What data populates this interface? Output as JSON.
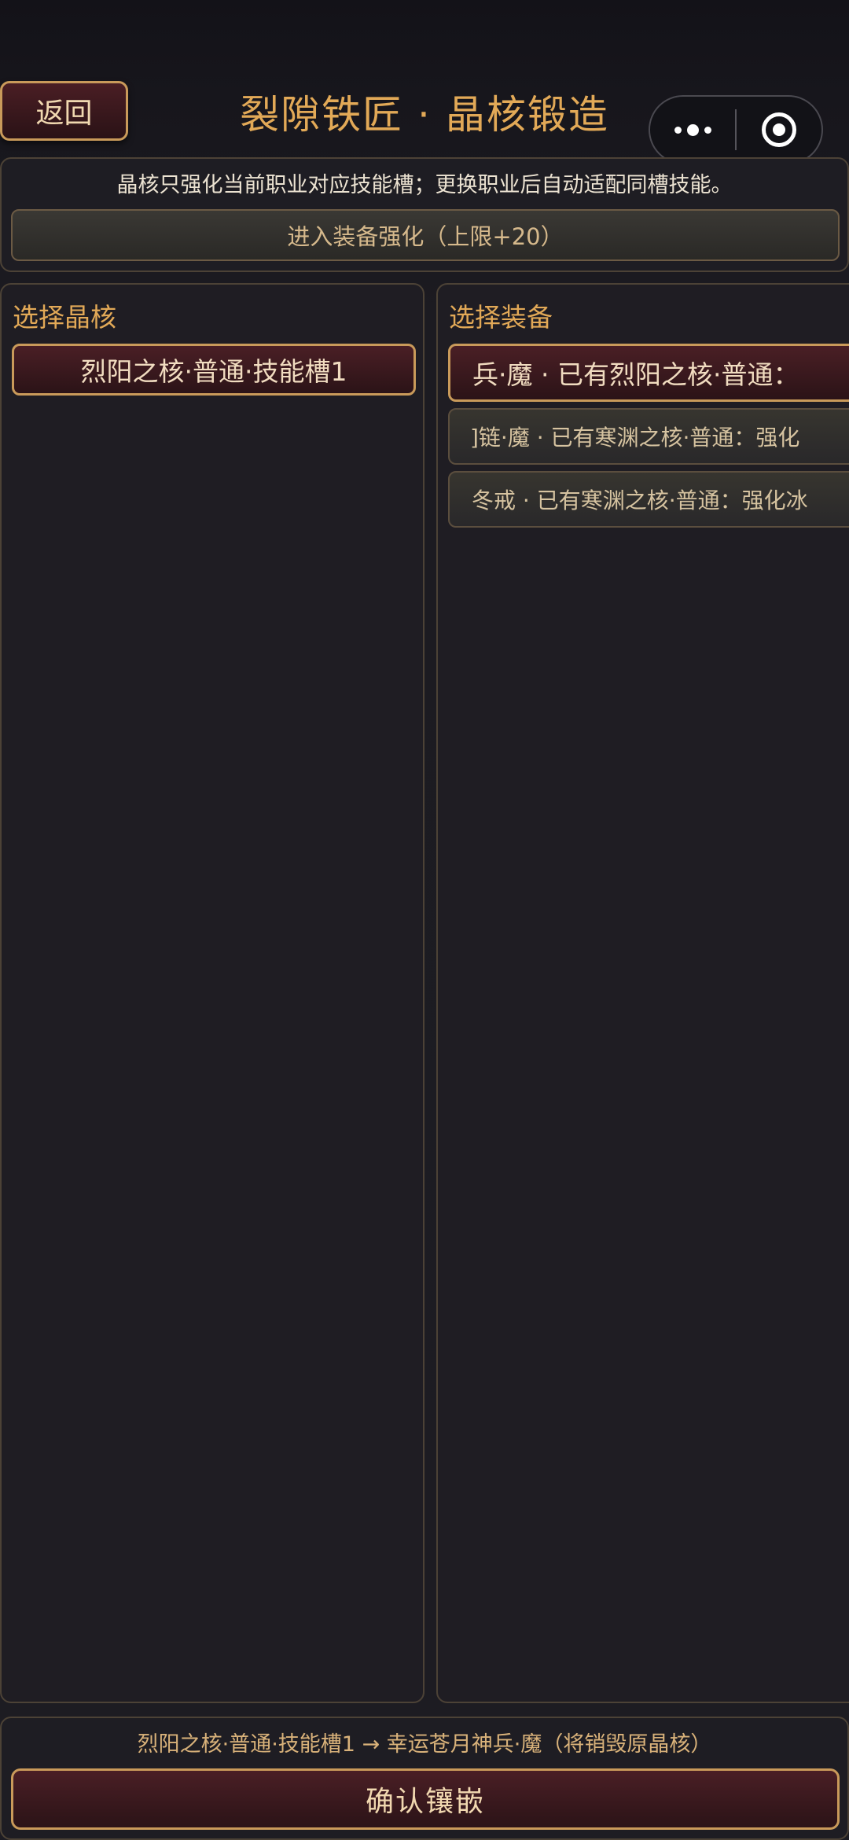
{
  "header": {
    "back_label": "返回",
    "title": "裂隙铁匠 · 晶核锻造"
  },
  "capsule": {
    "more_icon": "more-dots-icon",
    "close_icon": "target-circle-icon"
  },
  "info": {
    "text": "晶核只强化当前职业对应技能槽；更换职业后自动适配同槽技能。",
    "enhance_label": "进入装备强化（上限+20）"
  },
  "cores": {
    "title": "选择晶核",
    "items": [
      {
        "label": "烈阳之核·普通·技能槽1",
        "selected": true
      }
    ]
  },
  "equipment": {
    "title": "选择装备",
    "items": [
      {
        "label": "兵·魔 · 已有烈阳之核·普通：",
        "selected": true
      },
      {
        "label": "]链·魔 · 已有寒渊之核·普通：强化",
        "selected": false
      },
      {
        "label": "冬戒 · 已有寒渊之核·普通：强化冰",
        "selected": false
      }
    ]
  },
  "footer": {
    "summary": "烈阳之核·普通·技能槽1 → 幸运苍月神兵·魔（将销毁原晶核）",
    "confirm_label": "确认镶嵌"
  },
  "colors": {
    "accent_gold": "#e2a957",
    "border_gold": "#c99a5a",
    "button_maroon": "#4a1f25",
    "background": "#1d1c22"
  }
}
